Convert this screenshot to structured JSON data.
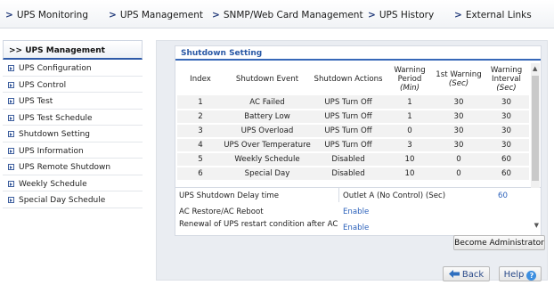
{
  "nav": {
    "items": [
      {
        "arrow": ">",
        "label": "UPS Monitoring"
      },
      {
        "arrow": ">",
        "label": "UPS Management"
      },
      {
        "arrow": ">",
        "label": "SNMP/Web Card Management"
      },
      {
        "arrow": ">",
        "label": "UPS History"
      },
      {
        "arrow": ">",
        "label": "External Links"
      }
    ]
  },
  "sidebar": {
    "header": ">> UPS Management",
    "items": [
      {
        "label": "UPS Configuration"
      },
      {
        "label": "UPS Control"
      },
      {
        "label": "UPS Test"
      },
      {
        "label": "UPS Test Schedule"
      },
      {
        "label": "Shutdown Setting"
      },
      {
        "label": "UPS Information"
      },
      {
        "label": "UPS Remote Shutdown"
      },
      {
        "label": "Weekly Schedule"
      },
      {
        "label": "Special Day Schedule"
      }
    ]
  },
  "section": {
    "title": "Shutdown Setting",
    "columns": {
      "index": "Index",
      "event": "Shutdown Event",
      "actions": "Shutdown Actions",
      "warn_period_1": "Warning",
      "warn_period_2": "Period",
      "warn_period_unit": "(Min)",
      "first_warn": "1st Warning",
      "first_warn_unit": "(Sec)",
      "warn_interval_1": "Warning",
      "warn_interval_2": "Interval",
      "warn_interval_unit": "(Sec)"
    },
    "rows": [
      {
        "index": "1",
        "event": "AC Failed",
        "action": "UPS Turn Off",
        "period": "1",
        "first": "30",
        "interval": "30"
      },
      {
        "index": "2",
        "event": "Battery Low",
        "action": "UPS Turn Off",
        "period": "1",
        "first": "30",
        "interval": "30"
      },
      {
        "index": "3",
        "event": "UPS Overload",
        "action": "UPS Turn Off",
        "period": "0",
        "first": "30",
        "interval": "30"
      },
      {
        "index": "4",
        "event": "UPS Over Temperature",
        "action": "UPS Turn Off",
        "period": "3",
        "first": "30",
        "interval": "30"
      },
      {
        "index": "5",
        "event": "Weekly Schedule",
        "action": "Disabled",
        "period": "10",
        "first": "0",
        "interval": "60"
      },
      {
        "index": "6",
        "event": "Special Day",
        "action": "Disabled",
        "period": "10",
        "first": "0",
        "interval": "60"
      }
    ]
  },
  "info": {
    "delay_label": "UPS Shutdown Delay time",
    "delay_outlet": "Outlet A (No Control) (Sec)",
    "delay_value": "60",
    "restore_label": "AC Restore/AC Reboot",
    "restore_value": "Enable",
    "renewal_label": "Renewal of UPS restart condition after AC",
    "renewal_value": "Enable"
  },
  "buttons": {
    "admin": "Become Administrator",
    "back": "Back",
    "help": "Help",
    "help_glyph": "?"
  }
}
